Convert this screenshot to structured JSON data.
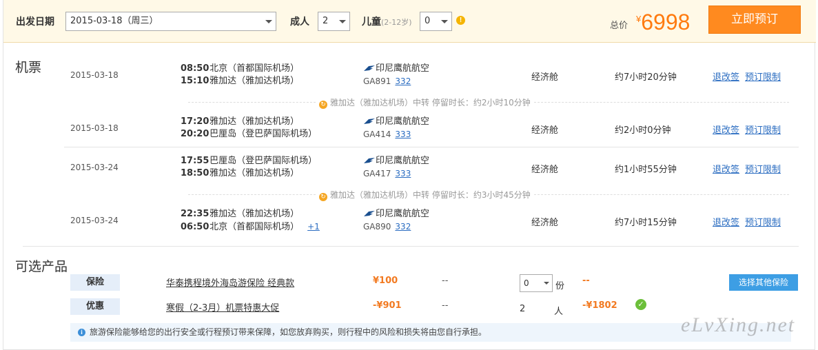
{
  "search": {
    "date_label": "出发日期",
    "date_value": "2015-03-18（周三）",
    "adult_label": "成人",
    "adult_value": "2",
    "child_label": "儿童",
    "child_hint": "(2-12岁)",
    "child_value": "0",
    "total_label": "总价",
    "currency": "¥",
    "total_price": "6998",
    "book_button": "立即预订"
  },
  "flights": {
    "section_title": "机票",
    "segments": [
      {
        "date": "2015-03-18",
        "dep_time": "08:50",
        "dep_airport": "北京（首都国际机场）",
        "arr_time": "15:10",
        "arr_airport": "雅加达（雅加达机场）",
        "plus_day": "",
        "airline": "印尼鹰航航空",
        "flight_no": "GA891",
        "aircraft": "332",
        "cabin": "经济舱",
        "duration": "约7小时20分钟",
        "refund_link": "退改签",
        "restrict_link": "预订限制"
      },
      {
        "date": "2015-03-18",
        "dep_time": "17:20",
        "dep_airport": "雅加达（雅加达机场）",
        "arr_time": "20:20",
        "arr_airport": "巴厘岛（登巴萨国际机场）",
        "plus_day": "",
        "airline": "印尼鹰航航空",
        "flight_no": "GA414",
        "aircraft": "333",
        "cabin": "经济舱",
        "duration": "约2小时0分钟",
        "refund_link": "退改签",
        "restrict_link": "预订限制"
      },
      {
        "date": "2015-03-24",
        "dep_time": "17:55",
        "dep_airport": "巴厘岛（登巴萨国际机场）",
        "arr_time": "18:50",
        "arr_airport": "雅加达（雅加达机场）",
        "plus_day": "",
        "airline": "印尼鹰航航空",
        "flight_no": "GA417",
        "aircraft": "333",
        "cabin": "经济舱",
        "duration": "约1小时55分钟",
        "refund_link": "退改签",
        "restrict_link": "预订限制"
      },
      {
        "date": "2015-03-24",
        "dep_time": "22:35",
        "dep_airport": "雅加达（雅加达机场）",
        "arr_time": "06:50",
        "arr_airport": "北京（首都国际机场）",
        "plus_day": "+1",
        "airline": "印尼鹰航航空",
        "flight_no": "GA890",
        "aircraft": "332",
        "cabin": "经济舱",
        "duration": "约7小时15分钟",
        "refund_link": "退改签",
        "restrict_link": "预订限制"
      }
    ],
    "transfers": [
      "雅加达（雅加达机场）中转 停留时长：约2小时10分钟",
      "雅加达（雅加达机场）中转 停留时长：约3小时45分钟"
    ]
  },
  "products": {
    "section_title": "可选产品",
    "insurance": {
      "tag": "保险",
      "name": "华泰携程境外海岛游保险 经典款",
      "price": "¥100",
      "dash": "--",
      "qty": "0",
      "unit": "份",
      "total": "--",
      "other_button": "选择其他保险"
    },
    "promo": {
      "tag": "优惠",
      "name": "寒假（2-3月）机票特惠大促",
      "price": "-¥901",
      "dash": "--",
      "qty": "2",
      "unit": "人",
      "total": "-¥1802"
    },
    "notice": "旅游保险能够给您的出行安全或行程预订带来保障，如您放弃购买，则行程中的风险和损失将由您自行承担。"
  },
  "watermark": "eLvXing.net",
  "colors": {
    "accent": "#ff8a1f",
    "link": "#2a6cc1",
    "price": "#ff7b0f",
    "topbar_bg": "#fff9e7"
  }
}
